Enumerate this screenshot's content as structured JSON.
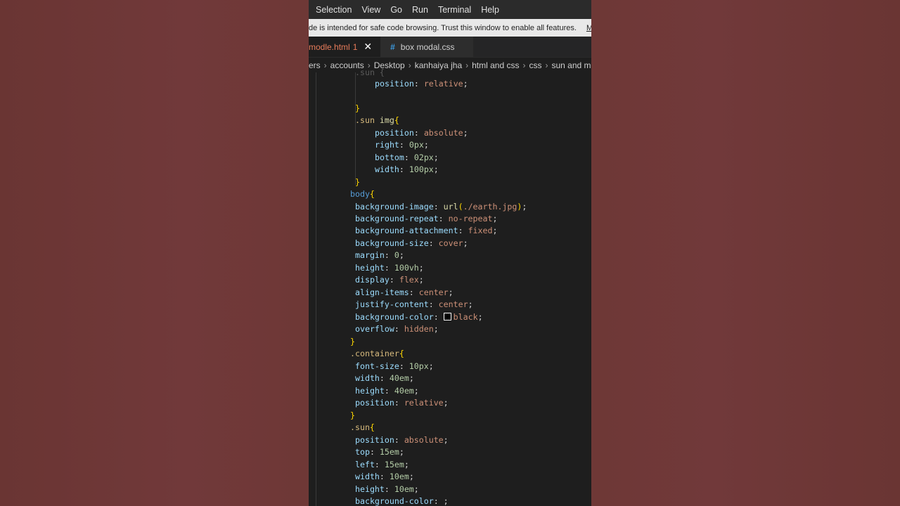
{
  "menu": [
    "Selection",
    "View",
    "Go",
    "Run",
    "Terminal",
    "Help"
  ],
  "restricted": {
    "message": "de is intended for safe code browsing. Trust this window to enable all features.",
    "manage": "M"
  },
  "tabs": {
    "active": {
      "label": "modle.html",
      "badge": "1",
      "close": "✕"
    },
    "inactive": {
      "label": "box modal.css",
      "icon": "#"
    }
  },
  "breadcrumb": [
    "ers",
    "accounts",
    "Desktop",
    "kanhaiya jha",
    "html and css",
    "css",
    "sun and mo"
  ],
  "code": {
    "l0": ".sun {",
    "l1p": "position",
    "l1v": "relative",
    "l3": "}",
    "l4s": ".sun",
    "l4t": "img",
    "l5p": "position",
    "l5v": "absolute",
    "l6p": "right",
    "l6v": "0",
    "l6u": "px",
    "l7p": "bottom",
    "l7v": "02",
    "l7u": "px",
    "l8p": "width",
    "l8v": "100",
    "l8u": "px",
    "l9": "}",
    "l10": "body",
    "l11p": "background-image",
    "l11f": "url",
    "l11v": "./earth.jpg",
    "l12p": "background-repeat",
    "l12v": "no-repeat",
    "l13p": "background-attachment",
    "l13v": "fixed",
    "l14p": "background-size",
    "l14v": "cover",
    "l15p": "margin",
    "l15v": "0",
    "l16p": "height",
    "l16v": "100",
    "l16u": "vh",
    "l17p": "display",
    "l17v": "flex",
    "l18p": "align-items",
    "l18v": "center",
    "l19p": "justify-content",
    "l19v": "center",
    "l20p": "background-color",
    "l20v": "black",
    "l21p": "overflow",
    "l21v": "hidden",
    "l22": "}",
    "l23": ".container",
    "l24p": "font-size",
    "l24v": "10",
    "l24u": "px",
    "l25p": "width",
    "l25v": "40",
    "l25u": "em",
    "l26p": "height",
    "l26v": "40",
    "l26u": "em",
    "l27p": "position",
    "l27v": "relative",
    "l28": "}",
    "l29": ".sun",
    "l30p": "position",
    "l30v": "absolute",
    "l31p": "top",
    "l31v": "15",
    "l31u": "em",
    "l32p": "left",
    "l32v": "15",
    "l32u": "em",
    "l33p": "width",
    "l33v": "10",
    "l33u": "em",
    "l34p": "height",
    "l34v": "10",
    "l34u": "em",
    "l35p": "background-color"
  }
}
